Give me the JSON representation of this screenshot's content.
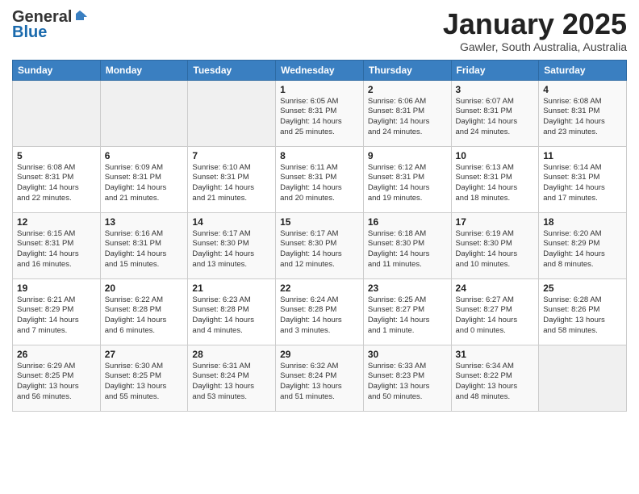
{
  "header": {
    "title": "January 2025",
    "location": "Gawler, South Australia, Australia"
  },
  "calendar": {
    "columns": [
      "Sunday",
      "Monday",
      "Tuesday",
      "Wednesday",
      "Thursday",
      "Friday",
      "Saturday"
    ],
    "weeks": [
      [
        {
          "day": "",
          "info": ""
        },
        {
          "day": "",
          "info": ""
        },
        {
          "day": "",
          "info": ""
        },
        {
          "day": "1",
          "info": "Sunrise: 6:05 AM\nSunset: 8:31 PM\nDaylight: 14 hours\nand 25 minutes."
        },
        {
          "day": "2",
          "info": "Sunrise: 6:06 AM\nSunset: 8:31 PM\nDaylight: 14 hours\nand 24 minutes."
        },
        {
          "day": "3",
          "info": "Sunrise: 6:07 AM\nSunset: 8:31 PM\nDaylight: 14 hours\nand 24 minutes."
        },
        {
          "day": "4",
          "info": "Sunrise: 6:08 AM\nSunset: 8:31 PM\nDaylight: 14 hours\nand 23 minutes."
        }
      ],
      [
        {
          "day": "5",
          "info": "Sunrise: 6:08 AM\nSunset: 8:31 PM\nDaylight: 14 hours\nand 22 minutes."
        },
        {
          "day": "6",
          "info": "Sunrise: 6:09 AM\nSunset: 8:31 PM\nDaylight: 14 hours\nand 21 minutes."
        },
        {
          "day": "7",
          "info": "Sunrise: 6:10 AM\nSunset: 8:31 PM\nDaylight: 14 hours\nand 21 minutes."
        },
        {
          "day": "8",
          "info": "Sunrise: 6:11 AM\nSunset: 8:31 PM\nDaylight: 14 hours\nand 20 minutes."
        },
        {
          "day": "9",
          "info": "Sunrise: 6:12 AM\nSunset: 8:31 PM\nDaylight: 14 hours\nand 19 minutes."
        },
        {
          "day": "10",
          "info": "Sunrise: 6:13 AM\nSunset: 8:31 PM\nDaylight: 14 hours\nand 18 minutes."
        },
        {
          "day": "11",
          "info": "Sunrise: 6:14 AM\nSunset: 8:31 PM\nDaylight: 14 hours\nand 17 minutes."
        }
      ],
      [
        {
          "day": "12",
          "info": "Sunrise: 6:15 AM\nSunset: 8:31 PM\nDaylight: 14 hours\nand 16 minutes."
        },
        {
          "day": "13",
          "info": "Sunrise: 6:16 AM\nSunset: 8:31 PM\nDaylight: 14 hours\nand 15 minutes."
        },
        {
          "day": "14",
          "info": "Sunrise: 6:17 AM\nSunset: 8:30 PM\nDaylight: 14 hours\nand 13 minutes."
        },
        {
          "day": "15",
          "info": "Sunrise: 6:17 AM\nSunset: 8:30 PM\nDaylight: 14 hours\nand 12 minutes."
        },
        {
          "day": "16",
          "info": "Sunrise: 6:18 AM\nSunset: 8:30 PM\nDaylight: 14 hours\nand 11 minutes."
        },
        {
          "day": "17",
          "info": "Sunrise: 6:19 AM\nSunset: 8:30 PM\nDaylight: 14 hours\nand 10 minutes."
        },
        {
          "day": "18",
          "info": "Sunrise: 6:20 AM\nSunset: 8:29 PM\nDaylight: 14 hours\nand 8 minutes."
        }
      ],
      [
        {
          "day": "19",
          "info": "Sunrise: 6:21 AM\nSunset: 8:29 PM\nDaylight: 14 hours\nand 7 minutes."
        },
        {
          "day": "20",
          "info": "Sunrise: 6:22 AM\nSunset: 8:28 PM\nDaylight: 14 hours\nand 6 minutes."
        },
        {
          "day": "21",
          "info": "Sunrise: 6:23 AM\nSunset: 8:28 PM\nDaylight: 14 hours\nand 4 minutes."
        },
        {
          "day": "22",
          "info": "Sunrise: 6:24 AM\nSunset: 8:28 PM\nDaylight: 14 hours\nand 3 minutes."
        },
        {
          "day": "23",
          "info": "Sunrise: 6:25 AM\nSunset: 8:27 PM\nDaylight: 14 hours\nand 1 minute."
        },
        {
          "day": "24",
          "info": "Sunrise: 6:27 AM\nSunset: 8:27 PM\nDaylight: 14 hours\nand 0 minutes."
        },
        {
          "day": "25",
          "info": "Sunrise: 6:28 AM\nSunset: 8:26 PM\nDaylight: 13 hours\nand 58 minutes."
        }
      ],
      [
        {
          "day": "26",
          "info": "Sunrise: 6:29 AM\nSunset: 8:25 PM\nDaylight: 13 hours\nand 56 minutes."
        },
        {
          "day": "27",
          "info": "Sunrise: 6:30 AM\nSunset: 8:25 PM\nDaylight: 13 hours\nand 55 minutes."
        },
        {
          "day": "28",
          "info": "Sunrise: 6:31 AM\nSunset: 8:24 PM\nDaylight: 13 hours\nand 53 minutes."
        },
        {
          "day": "29",
          "info": "Sunrise: 6:32 AM\nSunset: 8:24 PM\nDaylight: 13 hours\nand 51 minutes."
        },
        {
          "day": "30",
          "info": "Sunrise: 6:33 AM\nSunset: 8:23 PM\nDaylight: 13 hours\nand 50 minutes."
        },
        {
          "day": "31",
          "info": "Sunrise: 6:34 AM\nSunset: 8:22 PM\nDaylight: 13 hours\nand 48 minutes."
        },
        {
          "day": "",
          "info": ""
        }
      ]
    ]
  }
}
